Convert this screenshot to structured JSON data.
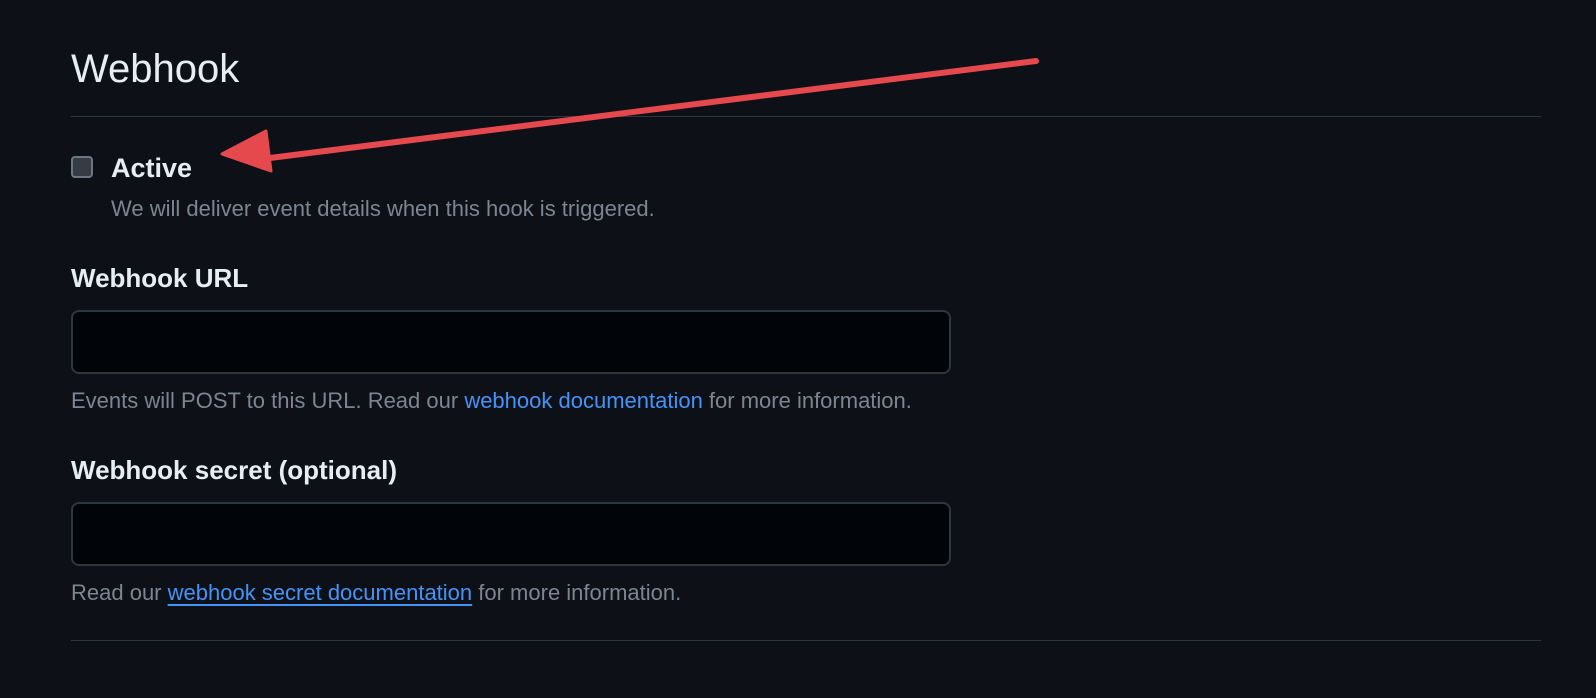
{
  "webhook": {
    "title": "Webhook",
    "active": {
      "label": "Active",
      "checked": false,
      "description": "We will deliver event details when this hook is triggered."
    },
    "url_field": {
      "label": "Webhook URL",
      "value": "",
      "help_prefix": "Events will POST to this URL. Read our ",
      "help_link": "webhook documentation",
      "help_suffix": " for more information."
    },
    "secret_field": {
      "label": "Webhook secret (optional)",
      "value": "",
      "help_prefix": "Read our ",
      "help_link": "webhook secret documentation",
      "help_suffix": " for more information."
    }
  },
  "annotation": {
    "arrow_color": "#e5484d",
    "icon": "red-arrow-annotation"
  },
  "colors": {
    "background": "#0d1117",
    "text": "#e6edf3",
    "muted": "#7d8590",
    "link": "#4493f8",
    "border": "#30363d",
    "input_bg": "#010409"
  }
}
